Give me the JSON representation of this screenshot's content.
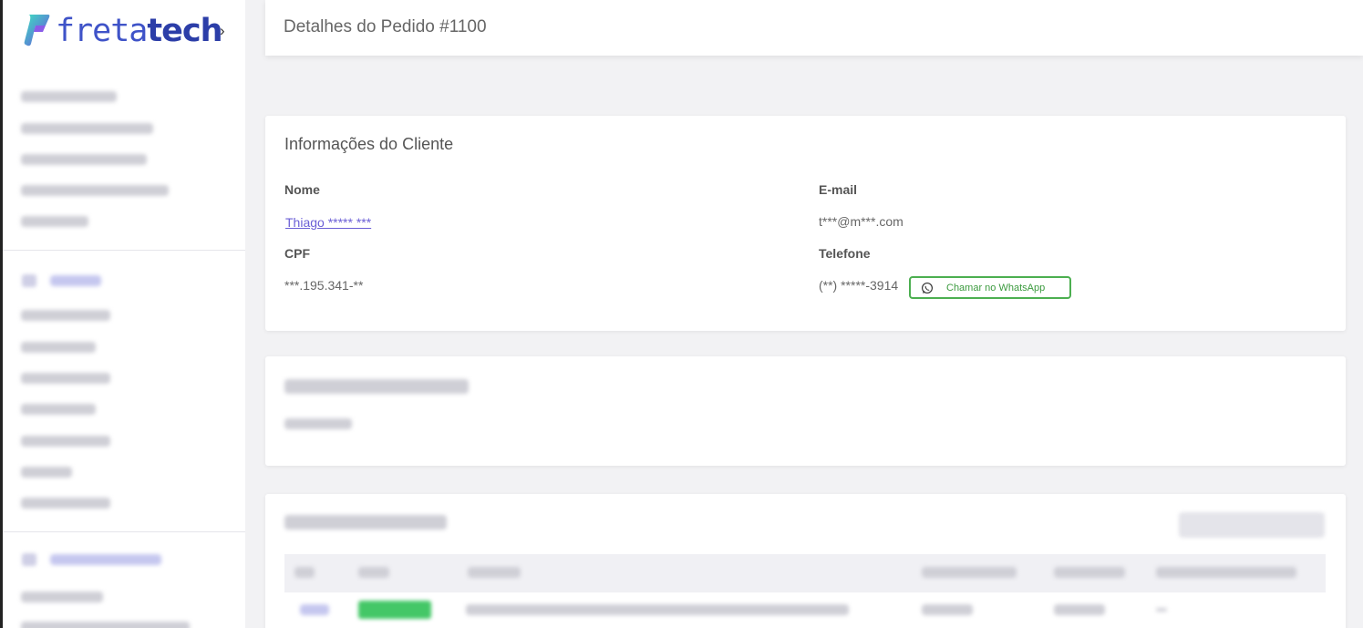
{
  "brand": {
    "name_light": "freta",
    "name_bold": "tech",
    "accent": "#3f53c8"
  },
  "sidebar": {
    "collapse_icon": "chevron-right-icon"
  },
  "header": {
    "title": "Detalhes do Pedido #1100"
  },
  "client": {
    "title": "Informações do Cliente",
    "name_label": "Nome",
    "name_value": "Thiago ***** ***",
    "email_label": "E-mail",
    "email_value": "t***@m***.com",
    "cpf_label": "CPF",
    "cpf_value": "***.195.341-**",
    "phone_label": "Telefone",
    "phone_value": "(**) *****-3914",
    "whatsapp_button": "Chamar no WhatsApp",
    "whatsapp_color": "#4caf50"
  }
}
